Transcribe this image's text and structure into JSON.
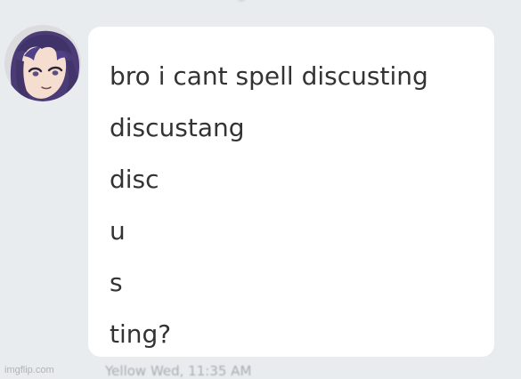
{
  "chat": {
    "avatar_icon": "anime-character-avatar-icon",
    "message": {
      "lines": [
        "bro i cant spell discusting",
        "discustang",
        "disc",
        "u",
        "s",
        "ting?"
      ]
    },
    "timestamp_text": "Yellow Wed, 11:35 AM"
  },
  "watermark": {
    "text": "imgflip.com"
  },
  "colors": {
    "page_bg": "#e9ecef",
    "bubble_bg": "#ffffff",
    "text": "#333333",
    "timestamp": "#a8acb2",
    "watermark": "#b2b2b2"
  }
}
